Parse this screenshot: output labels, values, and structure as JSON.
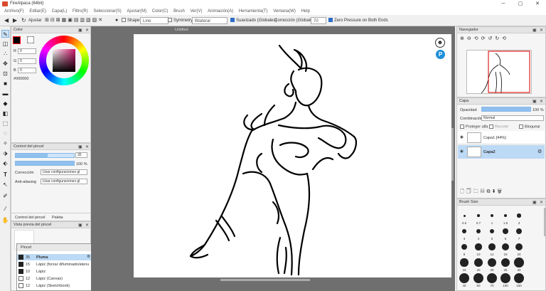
{
  "titlebar": {
    "title": "FireAlpaca (64bit)",
    "minimize": "─",
    "maximize": "▢",
    "close": "✕"
  },
  "menu": [
    "Archivo(F)",
    "Editar(E)",
    "Capa(L)",
    "Filtro(R)",
    "Seleccionar(S)",
    "Ajustar(M)",
    "Color(C)",
    "Brush",
    "Ver(V)",
    "Animación(A)",
    "Herramienta(T)",
    "Ventana(W)",
    "Help"
  ],
  "toolbar": {
    "adjust": "Ajustar",
    "shape_label": "Shape",
    "shape_value": "Line",
    "symmetry_label": "Symmetry",
    "symmetry_value": "Bilateral",
    "smooth_label": "Suavizado (Globales)",
    "correction_label": "Corrección (Globales)",
    "correction_value": "70",
    "zero_pressure": "Zero Pressure on Both Ends"
  },
  "canvas": {
    "title": "Untitled"
  },
  "color_panel": {
    "title": "Color",
    "r_label": "R",
    "r": "0",
    "g_label": "G",
    "g": "0",
    "b_label": "B",
    "b": "0",
    "hex": "#000000"
  },
  "brush_control": {
    "title": "Control del pincel",
    "size": "35",
    "opacity": "100 %",
    "correction_label": "Corrección",
    "correction_value": "Usar configuraciones gl",
    "antialias_label": "Anti-aliasing",
    "antialias_value": "Usar configuraciones gl",
    "tab1": "Control del pincel",
    "tab2": "Paleta",
    "preview_title": "Vista previa del pincel"
  },
  "brush_list": {
    "title": "Pincel",
    "items": [
      {
        "size": "35",
        "name": "Pluma"
      },
      {
        "size": "15",
        "name": "Lápiz (forzar difuminado/atenu"
      },
      {
        "size": "10",
        "name": "Lápiz"
      },
      {
        "size": "12",
        "name": "Lápiz (Canvas)"
      },
      {
        "size": "12",
        "name": "Lápiz (Sketchbook)"
      }
    ]
  },
  "navigator": {
    "title": "Navegador"
  },
  "layer_panel": {
    "title": "Capa",
    "opacity_label": "Opacidad",
    "opacity_value": "100 %",
    "blend_label": "Combinación",
    "blend_value": "Normal",
    "protect_alpha": "Proteger alfa",
    "clipping": "Recorte",
    "lock": "Bloquear",
    "layers": [
      {
        "name": "Capa1 [44%]",
        "selected": false
      },
      {
        "name": "Capa2",
        "selected": true
      }
    ]
  },
  "brush_size_panel": {
    "title": "Brush Size",
    "rows": [
      [
        "0.5",
        "0.7",
        "1",
        "1.5",
        "3"
      ],
      [
        "3",
        "4",
        "5",
        "6",
        "7"
      ],
      [
        "8",
        "10",
        "12",
        "15",
        "20"
      ],
      [
        "15",
        "20",
        "30",
        "35",
        "30"
      ],
      [
        "40",
        "50",
        "70",
        "100",
        "150"
      ]
    ]
  },
  "colors": {
    "accent": "#2d6cc7",
    "selection": "#bcd9f5"
  }
}
